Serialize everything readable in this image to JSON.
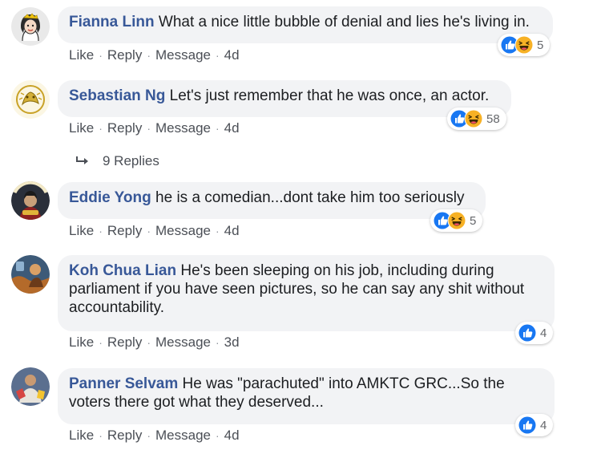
{
  "actions": {
    "like": "Like",
    "reply": "Reply",
    "message": "Message",
    "separator": "·"
  },
  "comments": [
    {
      "author": "Fianna Linn",
      "text": "What a nice little bubble of denial and lies he's living in.",
      "time": "4d",
      "reactions": [
        "like",
        "haha"
      ],
      "count": "5",
      "avatar": "drawn-avatar-icon"
    },
    {
      "author": "Sebastian Ng",
      "text": "Let's just remember that he was once, an actor.",
      "time": "4d",
      "reactions": [
        "like",
        "haha"
      ],
      "count": "58",
      "avatar": "gold-emblem-avatar-icon"
    },
    {
      "author": "Eddie Yong",
      "text": "he is a comedian...dont take him too seriously",
      "time": "4d",
      "reactions": [
        "like",
        "haha"
      ],
      "count": "5",
      "avatar": "new-year-photo-avatar-icon"
    },
    {
      "author": "Koh Chua Lian",
      "text": "He's been sleeping on his job, including during parliament if you have seen pictures, so he can say any shit without accountability.",
      "time": "3d",
      "reactions": [
        "like"
      ],
      "count": "4",
      "avatar": "photo-avatar-icon"
    },
    {
      "author": "Panner Selvam",
      "text": "He was \"parachuted\" into AMKTC GRC...So the voters there got what they deserved...",
      "time": "4d",
      "reactions": [
        "like"
      ],
      "count": "4",
      "avatar": "photo-avatar-icon"
    }
  ],
  "replies": {
    "label": "9 Replies"
  },
  "colors": {
    "author": "#385898",
    "bubble": "#f2f3f5",
    "like": "#1877f2",
    "haha": "#f7b125",
    "meta": "#4b4f56"
  }
}
